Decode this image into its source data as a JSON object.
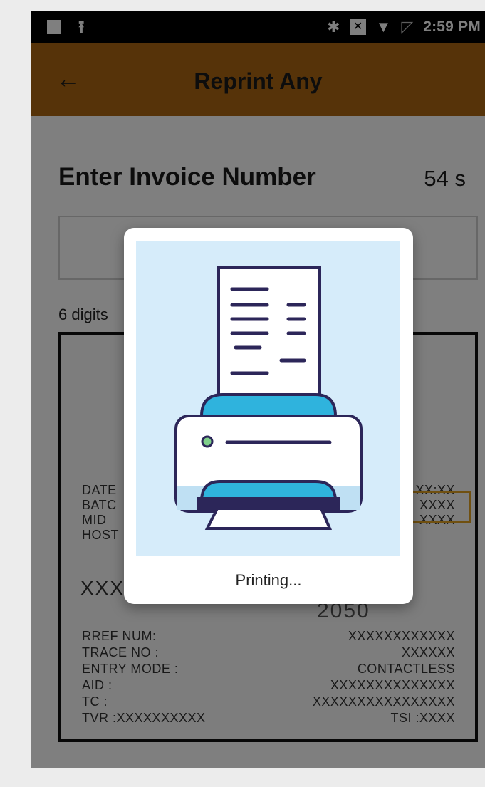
{
  "status_bar": {
    "time": "2:59 PM",
    "icons": [
      "notification-square-icon",
      "upload-icon",
      "bluetooth-icon",
      "network-x-icon",
      "wifi-icon",
      "no-sim-icon"
    ]
  },
  "toolbar": {
    "title": "Reprint Any",
    "back_icon": "arrow-left-icon",
    "color": "#ad6613"
  },
  "form": {
    "heading": "Enter Invoice Number",
    "timer": "54 s",
    "invoice_value": "",
    "hint": "6 digits"
  },
  "receipt": {
    "rows": [
      {
        "label": "RREF NUM:",
        "value": "XXXXXXXXXXXX"
      },
      {
        "label": "TRACE NO :",
        "value": "XXXXXX"
      },
      {
        "label": "ENTRY MODE :",
        "value": "CONTACTLESS"
      },
      {
        "label": "AID :",
        "value": "XXXXXXXXXXXXXX"
      },
      {
        "label": "TC :",
        "value": "XXXXXXXXXXXXXXXX"
      },
      {
        "label": "TVR :XXXXXXXXXX",
        "value": "TSI :XXXX"
      }
    ],
    "partial_labels": [
      "DATE",
      "BATC",
      "MID",
      "HOST"
    ],
    "partial_values": [
      "XX:XX",
      "XXXX",
      "XXXX"
    ],
    "big_value": "XXX",
    "amount_partial": "2050"
  },
  "dialog": {
    "message": "Printing...",
    "illustration_icon": "printer-icon",
    "accent": "#2fb3dd",
    "outline": "#2c2659"
  }
}
